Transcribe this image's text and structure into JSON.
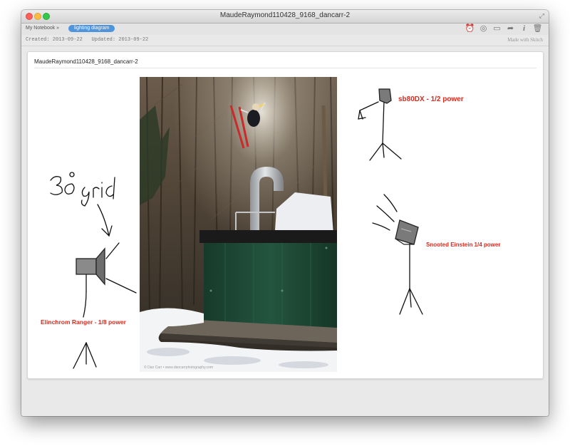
{
  "window": {
    "title": "MaudeRaymond110428_9168_dancarr-2"
  },
  "toolbar": {
    "breadcrumb": "My Notebook »",
    "tag": "lighting diagram",
    "icons": [
      "reminder-icon",
      "share-circle-icon",
      "present-icon",
      "share-arrow-icon",
      "info-icon",
      "trash-icon"
    ]
  },
  "meta": {
    "created": "Created: 2013-09-22",
    "updated": "Updated: 2013-09-22",
    "made_with": "Made with Skitch"
  },
  "note": {
    "title": "MaudeRaymond110428_9168_dancarr-2",
    "photo_credit": "© Dan Carr • www.dancarrphotography.com",
    "annotations": {
      "handwritten": "30° grid",
      "sb80dx": "sb80DX - 1/2 power",
      "einstein": "Snooted Einstein 1/4 power",
      "elinchrom": "Elinchrom Ranger - 1/8 power"
    }
  },
  "colors": {
    "caption_red": "#d92b1e",
    "tag_blue": "#4f95dd",
    "tank_green": "#1f4a38"
  }
}
